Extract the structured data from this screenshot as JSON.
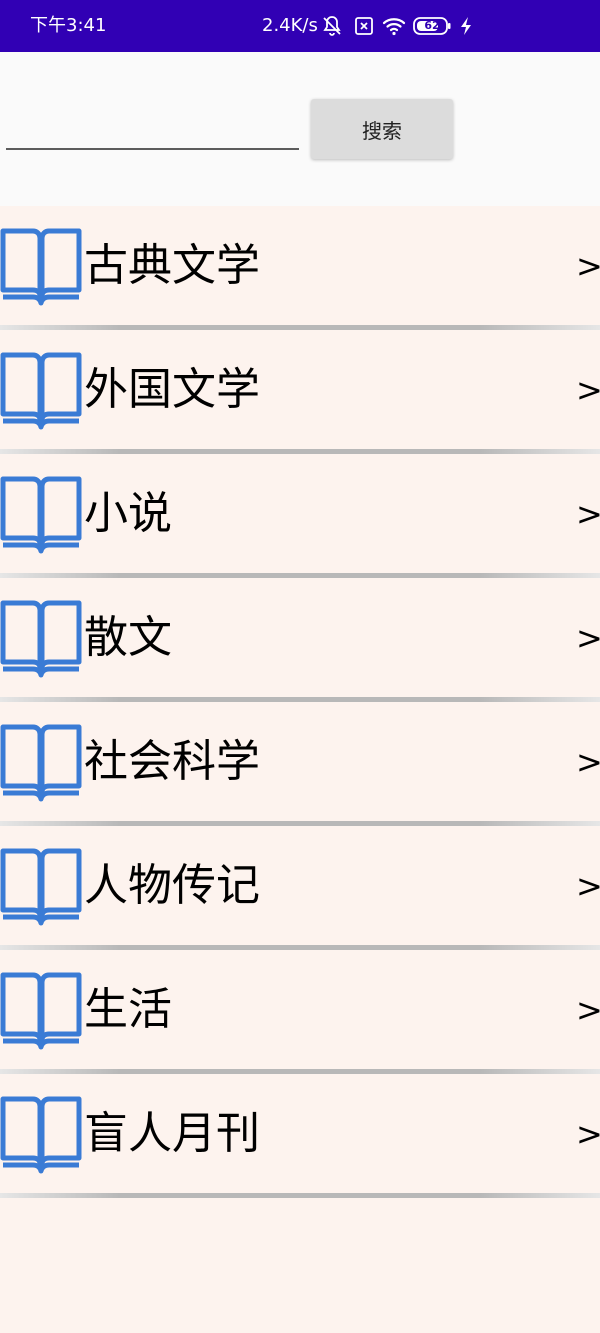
{
  "status_bar": {
    "time": "下午3:41",
    "network_speed": "2.4K/s",
    "battery_level": "62",
    "icons": [
      "bell-off-icon",
      "sim-x-icon",
      "wifi-icon",
      "battery-icon",
      "charging-icon"
    ],
    "background_color": "#3100b4"
  },
  "search": {
    "input_value": "",
    "placeholder": "",
    "button_label": "搜索"
  },
  "categories": [
    {
      "label": "古典文学",
      "chevron": ">",
      "icon": "book-icon"
    },
    {
      "label": "外国文学",
      "chevron": ">",
      "icon": "book-icon"
    },
    {
      "label": "小说",
      "chevron": ">",
      "icon": "book-icon"
    },
    {
      "label": "散文",
      "chevron": ">",
      "icon": "book-icon"
    },
    {
      "label": "社会科学",
      "chevron": ">",
      "icon": "book-icon"
    },
    {
      "label": "人物传记",
      "chevron": ">",
      "icon": "book-icon"
    },
    {
      "label": "生活",
      "chevron": ">",
      "icon": "book-icon"
    },
    {
      "label": "盲人月刊",
      "chevron": ">",
      "icon": "book-icon"
    }
  ],
  "colors": {
    "accent_icon": "#3a7bd5",
    "list_background": "#fdf3ee"
  }
}
